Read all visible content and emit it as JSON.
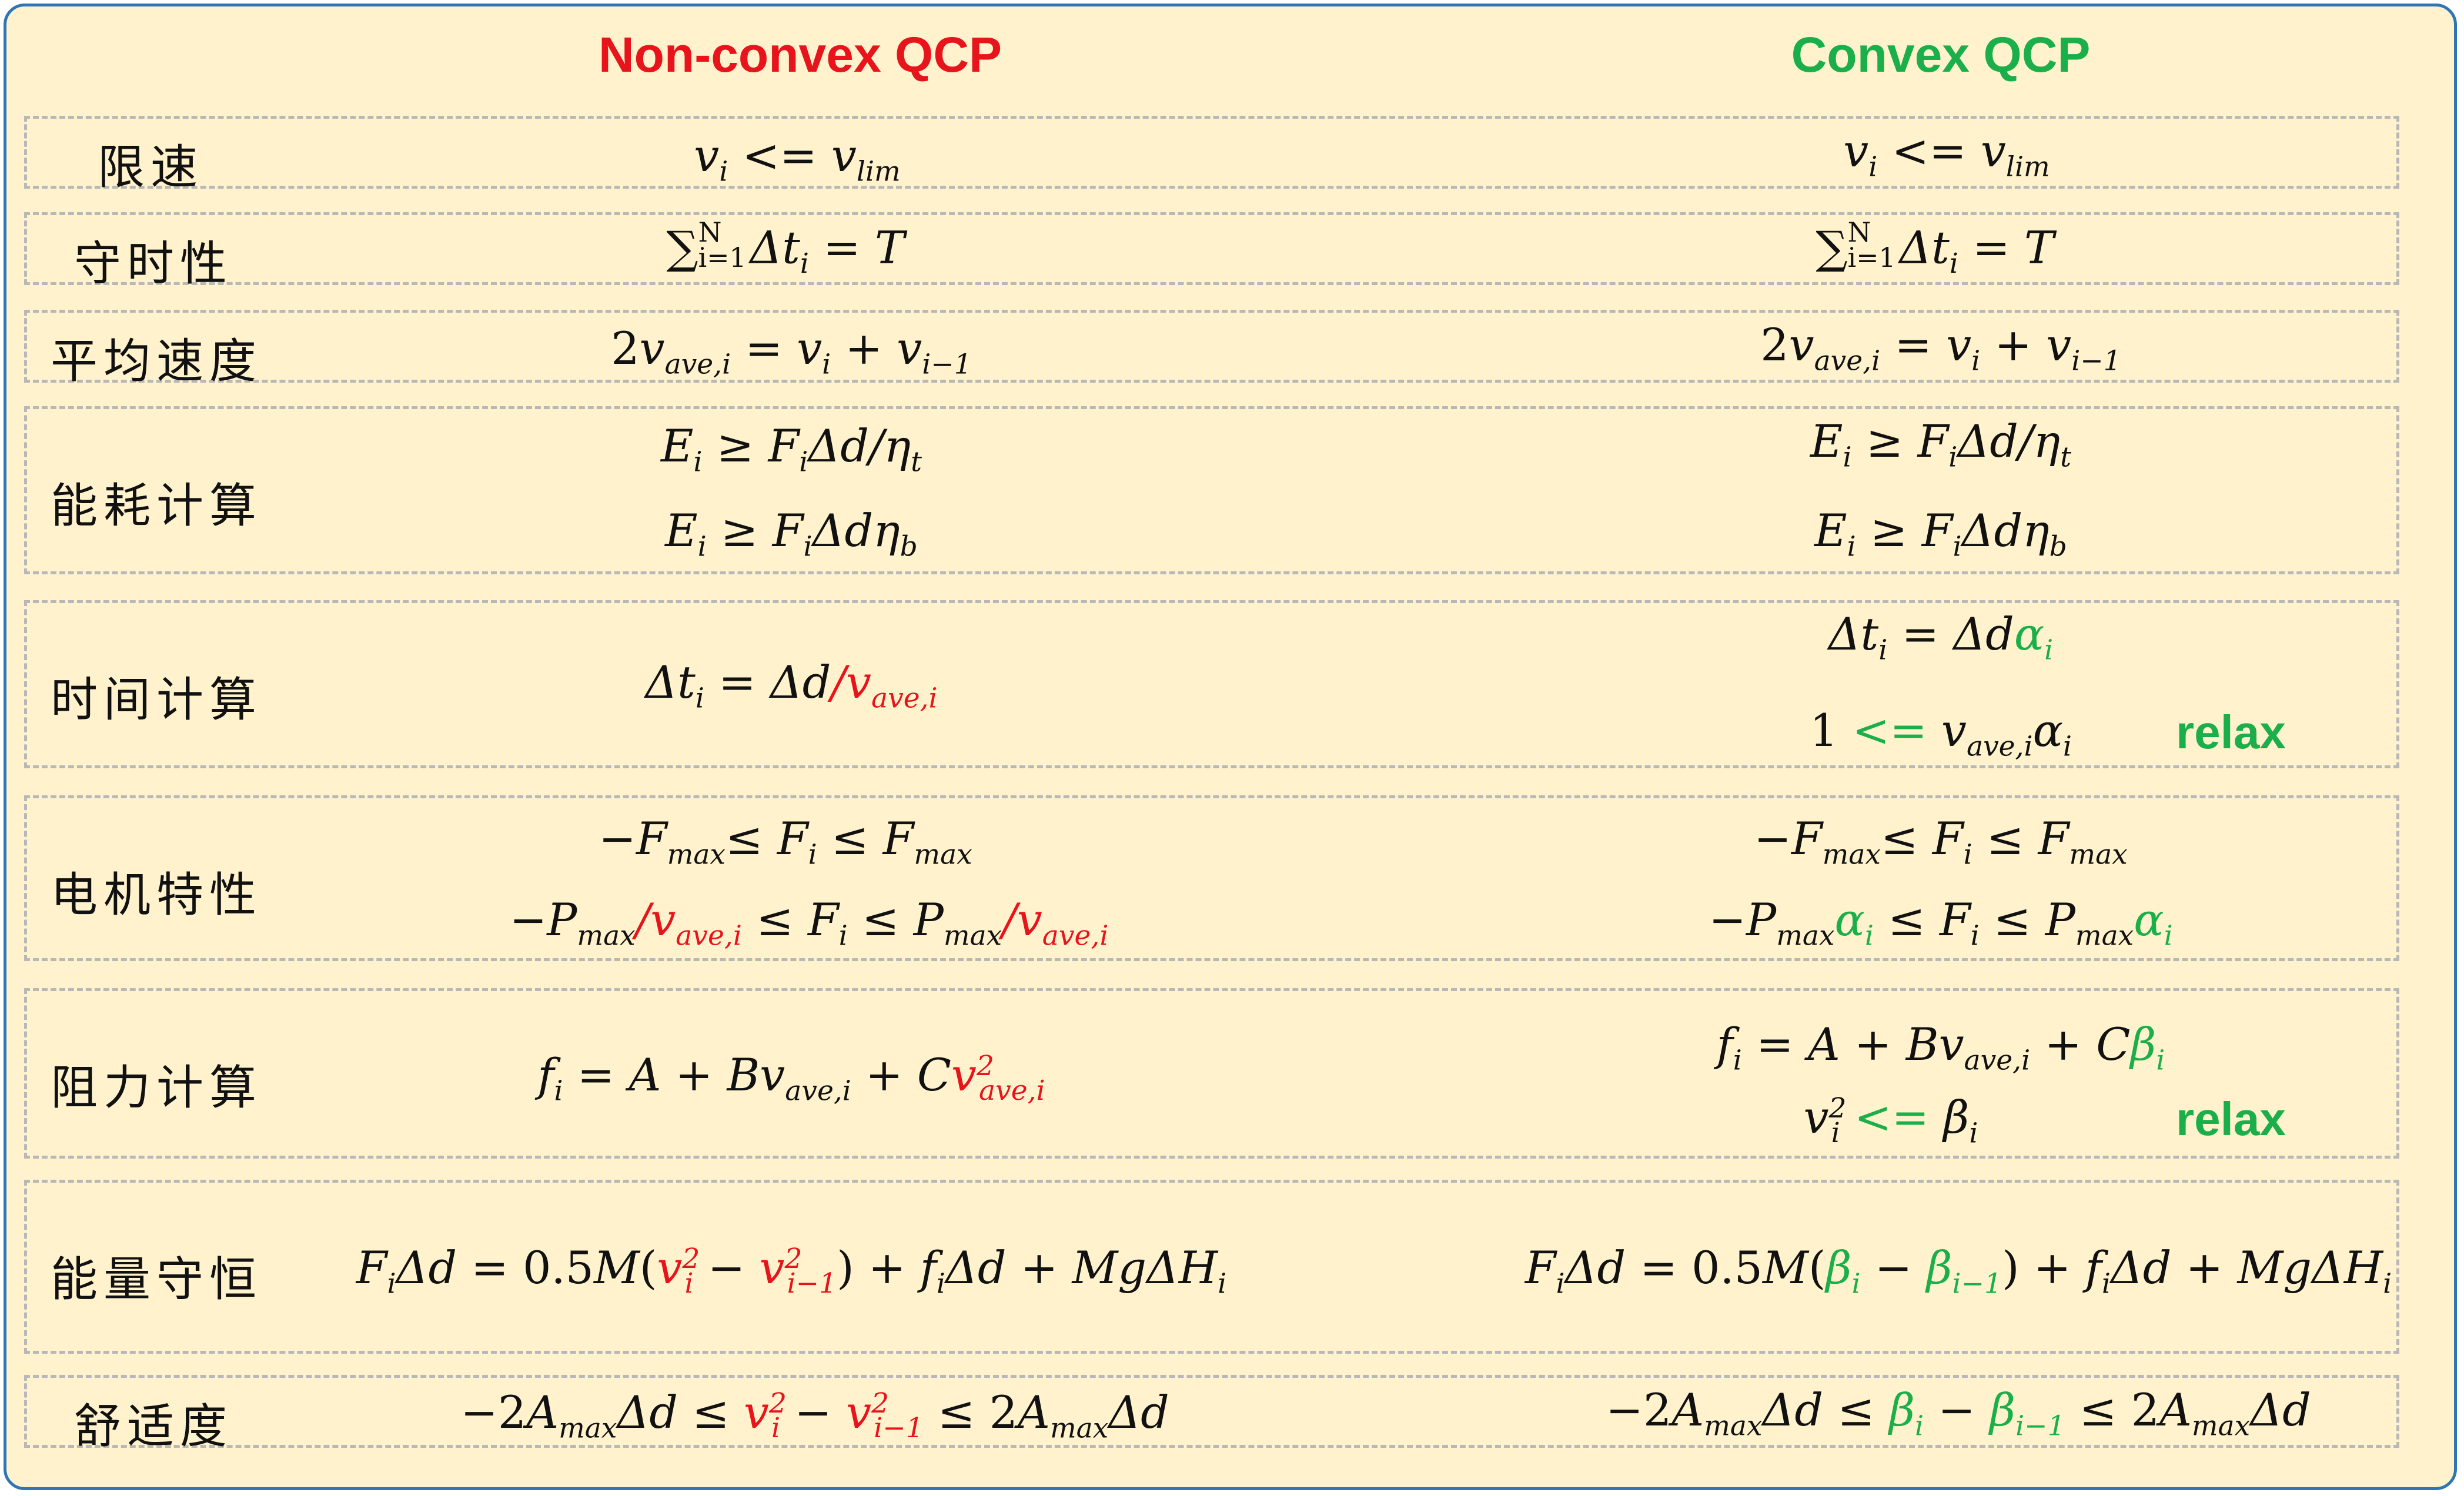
{
  "headers": {
    "nonconvex": "Non-convex QCP",
    "convex": "Convex QCP"
  },
  "colors": {
    "nonconvex_header": "#e8141c",
    "convex_header": "#1aaf4b",
    "frame": "#2e75b6",
    "background": "#fff2cc"
  },
  "rows": [
    {
      "label": "限速"
    },
    {
      "label": "守时性"
    },
    {
      "label": "平均速度"
    },
    {
      "label": "能耗计算"
    },
    {
      "label": "时间计算"
    },
    {
      "label": "电机特性"
    },
    {
      "label": "阻力计算"
    },
    {
      "label": "能量守恒"
    },
    {
      "label": "舒适度"
    }
  ],
  "relax_label": "relax"
}
